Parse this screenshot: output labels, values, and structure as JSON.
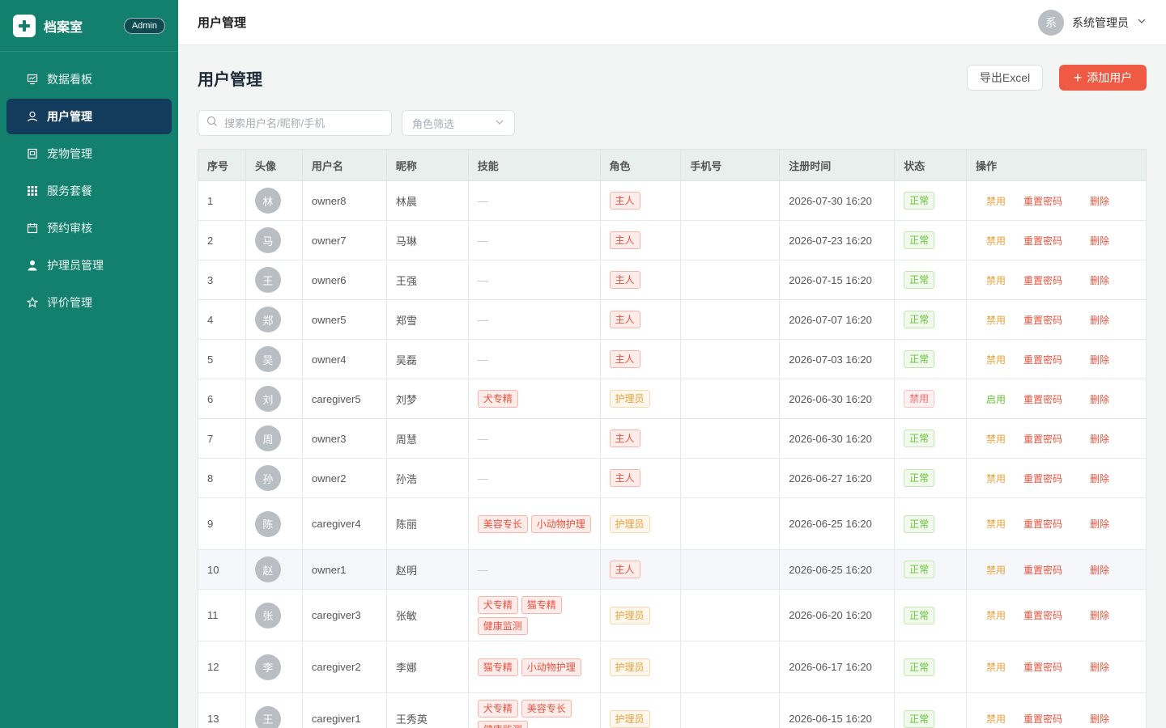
{
  "brand": {
    "name": "档案室",
    "badge": "Admin"
  },
  "nav": [
    {
      "label": "数据看板",
      "icon": "dashboard-icon",
      "active": false
    },
    {
      "label": "用户管理",
      "icon": "user-icon",
      "active": true
    },
    {
      "label": "宠物管理",
      "icon": "pet-icon",
      "active": false
    },
    {
      "label": "服务套餐",
      "icon": "grid-icon",
      "active": false
    },
    {
      "label": "预约审核",
      "icon": "calendar-icon",
      "active": false
    },
    {
      "label": "护理员管理",
      "icon": "caregiver-icon",
      "active": false
    },
    {
      "label": "评价管理",
      "icon": "star-icon",
      "active": false
    }
  ],
  "header": {
    "title": "用户管理",
    "user_avatar": "系",
    "user_name": "系统管理员"
  },
  "page": {
    "title": "用户管理",
    "export_label": "导出Excel",
    "add_label": "添加用户"
  },
  "search": {
    "placeholder": "搜索用户名/昵称/手机"
  },
  "role_filter": {
    "placeholder": "角色筛选"
  },
  "table": {
    "columns": [
      "序号",
      "头像",
      "用户名",
      "昵称",
      "技能",
      "角色",
      "手机号",
      "注册时间",
      "状态",
      "操作"
    ],
    "actions": {
      "ban": "禁用",
      "enable": "启用",
      "reset": "重置密码",
      "delete": "删除"
    },
    "rows": [
      {
        "no": "1",
        "avatar": "林",
        "username": "owner8",
        "nickname": "林晨",
        "skills": [],
        "role": "主人",
        "phone": "",
        "time": "2026-07-30 16:20",
        "status": "正常"
      },
      {
        "no": "2",
        "avatar": "马",
        "username": "owner7",
        "nickname": "马琳",
        "skills": [],
        "role": "主人",
        "phone": "",
        "time": "2026-07-23 16:20",
        "status": "正常"
      },
      {
        "no": "3",
        "avatar": "王",
        "username": "owner6",
        "nickname": "王强",
        "skills": [],
        "role": "主人",
        "phone": "",
        "time": "2026-07-15 16:20",
        "status": "正常"
      },
      {
        "no": "4",
        "avatar": "郑",
        "username": "owner5",
        "nickname": "郑雪",
        "skills": [],
        "role": "主人",
        "phone": "",
        "time": "2026-07-07 16:20",
        "status": "正常"
      },
      {
        "no": "5",
        "avatar": "吴",
        "username": "owner4",
        "nickname": "吴磊",
        "skills": [],
        "role": "主人",
        "phone": "",
        "time": "2026-07-03 16:20",
        "status": "正常"
      },
      {
        "no": "6",
        "avatar": "刘",
        "username": "caregiver5",
        "nickname": "刘梦",
        "skills": [
          "犬专精"
        ],
        "role": "护理员",
        "phone": "",
        "time": "2026-06-30 16:20",
        "status": "禁用"
      },
      {
        "no": "7",
        "avatar": "周",
        "username": "owner3",
        "nickname": "周慧",
        "skills": [],
        "role": "主人",
        "phone": "",
        "time": "2026-06-30 16:20",
        "status": "正常"
      },
      {
        "no": "8",
        "avatar": "孙",
        "username": "owner2",
        "nickname": "孙浩",
        "skills": [],
        "role": "主人",
        "phone": "",
        "time": "2026-06-27 16:20",
        "status": "正常"
      },
      {
        "no": "9",
        "avatar": "陈",
        "username": "caregiver4",
        "nickname": "陈丽",
        "skills": [
          "美容专长",
          "小动物护理"
        ],
        "role": "护理员",
        "phone": "",
        "time": "2026-06-25 16:20",
        "status": "正常"
      },
      {
        "no": "10",
        "avatar": "赵",
        "username": "owner1",
        "nickname": "赵明",
        "skills": [],
        "role": "主人",
        "phone": "",
        "time": "2026-06-25 16:20",
        "status": "正常",
        "highlight": true
      },
      {
        "no": "11",
        "avatar": "张",
        "username": "caregiver3",
        "nickname": "张敏",
        "skills": [
          "犬专精",
          "猫专精",
          "健康监测"
        ],
        "role": "护理员",
        "phone": "",
        "time": "2026-06-20 16:20",
        "status": "正常"
      },
      {
        "no": "12",
        "avatar": "李",
        "username": "caregiver2",
        "nickname": "李娜",
        "skills": [
          "猫专精",
          "小动物护理"
        ],
        "role": "护理员",
        "phone": "",
        "time": "2026-06-17 16:20",
        "status": "正常"
      },
      {
        "no": "13",
        "avatar": "王",
        "username": "caregiver1",
        "nickname": "王秀英",
        "skills": [
          "犬专精",
          "美容专长",
          "健康监测"
        ],
        "role": "护理员",
        "phone": "",
        "time": "2026-06-15 16:20",
        "status": "正常"
      }
    ]
  }
}
